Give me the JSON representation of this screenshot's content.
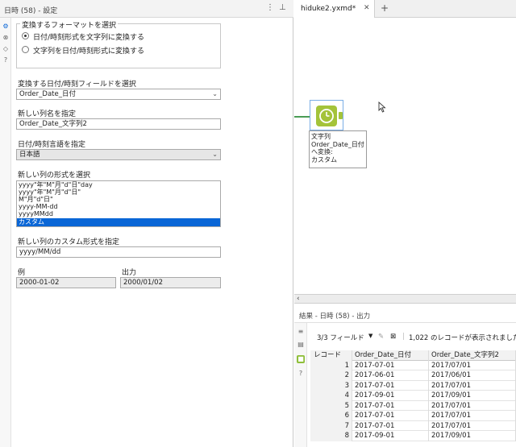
{
  "panel": {
    "title": "日時 (58) - 設定",
    "menu_icon": "⋮",
    "pin_icon": "⊥"
  },
  "format_group": {
    "legend": "変換するフォーマットを選択",
    "option1": "日付/時刻形式を文字列に変換する",
    "option2": "文字列を日付/時刻形式に変換する"
  },
  "field_select": {
    "label": "変換する日付/時刻フィールドを選択",
    "value": "Order_Date_日付"
  },
  "new_column": {
    "label": "新しい列名を指定",
    "value": "Order_Date_文字列2"
  },
  "language": {
    "label": "日付/時刻言語を指定",
    "value": "日本語"
  },
  "format_list": {
    "label": "新しい列の形式を選択",
    "items": [
      "yyyy\"年\"M\"月\"d\"日\"day",
      "yyyy\"年\"M\"月\"d\"日\"",
      "M\"月\"d\"日\"",
      "yyyy-MM-dd",
      "yyyyMMdd",
      "カスタム"
    ]
  },
  "custom_format": {
    "label": "新しい列のカスタム形式を指定",
    "value": "yyyy/MM/dd"
  },
  "example": {
    "label": "例",
    "value": "2000-01-02"
  },
  "output": {
    "label": "出力",
    "value": "2000/01/02"
  },
  "canvas": {
    "tab_label": "hiduke2.yxmd*",
    "tab_close": "✕",
    "tab_add": "+",
    "tool_annotation": [
      "文字列",
      "Order_Date_日付",
      "へ変換:",
      "カスタム"
    ]
  },
  "results": {
    "title": "結果 - 日時 (58) - 出力",
    "field_count": "3/3 フィールド",
    "record_summary": "1,022 のレコードが表示されました",
    "columns": [
      "レコード",
      "Order_Date_日付",
      "Order_Date_文字列2"
    ],
    "rows": [
      [
        "1",
        "2017-07-01",
        "2017/07/01"
      ],
      [
        "2",
        "2017-06-01",
        "2017/06/01"
      ],
      [
        "3",
        "2017-07-01",
        "2017/07/01"
      ],
      [
        "4",
        "2017-09-01",
        "2017/09/01"
      ],
      [
        "5",
        "2017-07-01",
        "2017/07/01"
      ],
      [
        "6",
        "2017-07-01",
        "2017/07/01"
      ],
      [
        "7",
        "2017-07-01",
        "2017/07/01"
      ],
      [
        "8",
        "2017-09-01",
        "2017/09/01"
      ]
    ]
  },
  "colors": {
    "accent": "#0a66d6",
    "tool_green": "#a4c33a",
    "connection": "#4a9c55"
  }
}
